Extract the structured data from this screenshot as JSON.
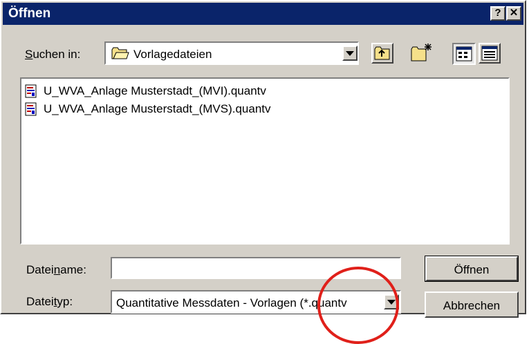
{
  "window": {
    "title": "Öffnen",
    "help_label": "?",
    "close_label": "✕"
  },
  "look_in": {
    "label": "Suchen in:",
    "folder": "Vorlagedateien"
  },
  "toolbar": {
    "up_icon": "folder-up-icon",
    "new_folder_icon": "new-folder-icon",
    "list_view_icon": "list-view-icon",
    "details_view_icon": "details-view-icon"
  },
  "files": [
    {
      "name": "U_WVA_Anlage Musterstadt_(MVI).quantv",
      "icon": "document-icon"
    },
    {
      "name": "U_WVA_Anlage Musterstadt_(MVS).quantv",
      "icon": "document-icon"
    }
  ],
  "filename": {
    "label": "Dateiname:",
    "value": ""
  },
  "filetype": {
    "label": "Dateityp:",
    "value": "Quantitative Messdaten - Vorlagen (*.quantv"
  },
  "buttons": {
    "open": "Öffnen",
    "cancel": "Abbrechen"
  },
  "annotation_color": "#e0201a"
}
